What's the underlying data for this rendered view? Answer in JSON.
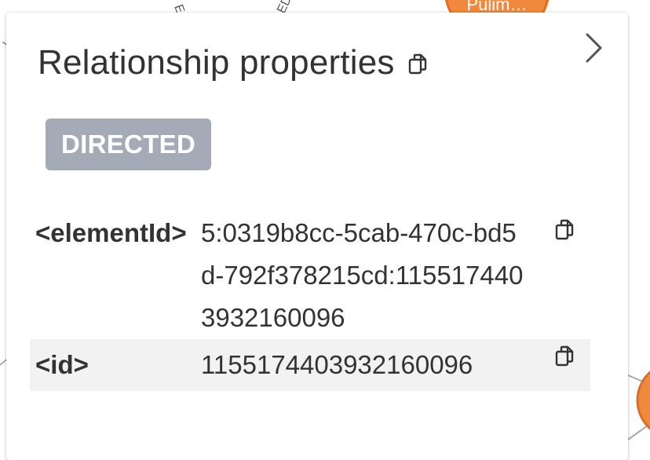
{
  "graph": {
    "node_label": "Pulim…",
    "node_color": "#f0883e",
    "edge_color": "#a5abb6"
  },
  "panel": {
    "title": "Relationship properties",
    "copy_icon": "copy-icon",
    "collapse_icon": "chevron-right-icon",
    "type_badge": {
      "label": "DIRECTED",
      "color": "#a5abb6"
    },
    "properties": [
      {
        "key": "<elementId>",
        "value": "5:0319b8cc-5cab-470c-bd5d-792f378215cd:1155174403932160096"
      },
      {
        "key": "<id>",
        "value": "1155174403932160096"
      }
    ]
  }
}
